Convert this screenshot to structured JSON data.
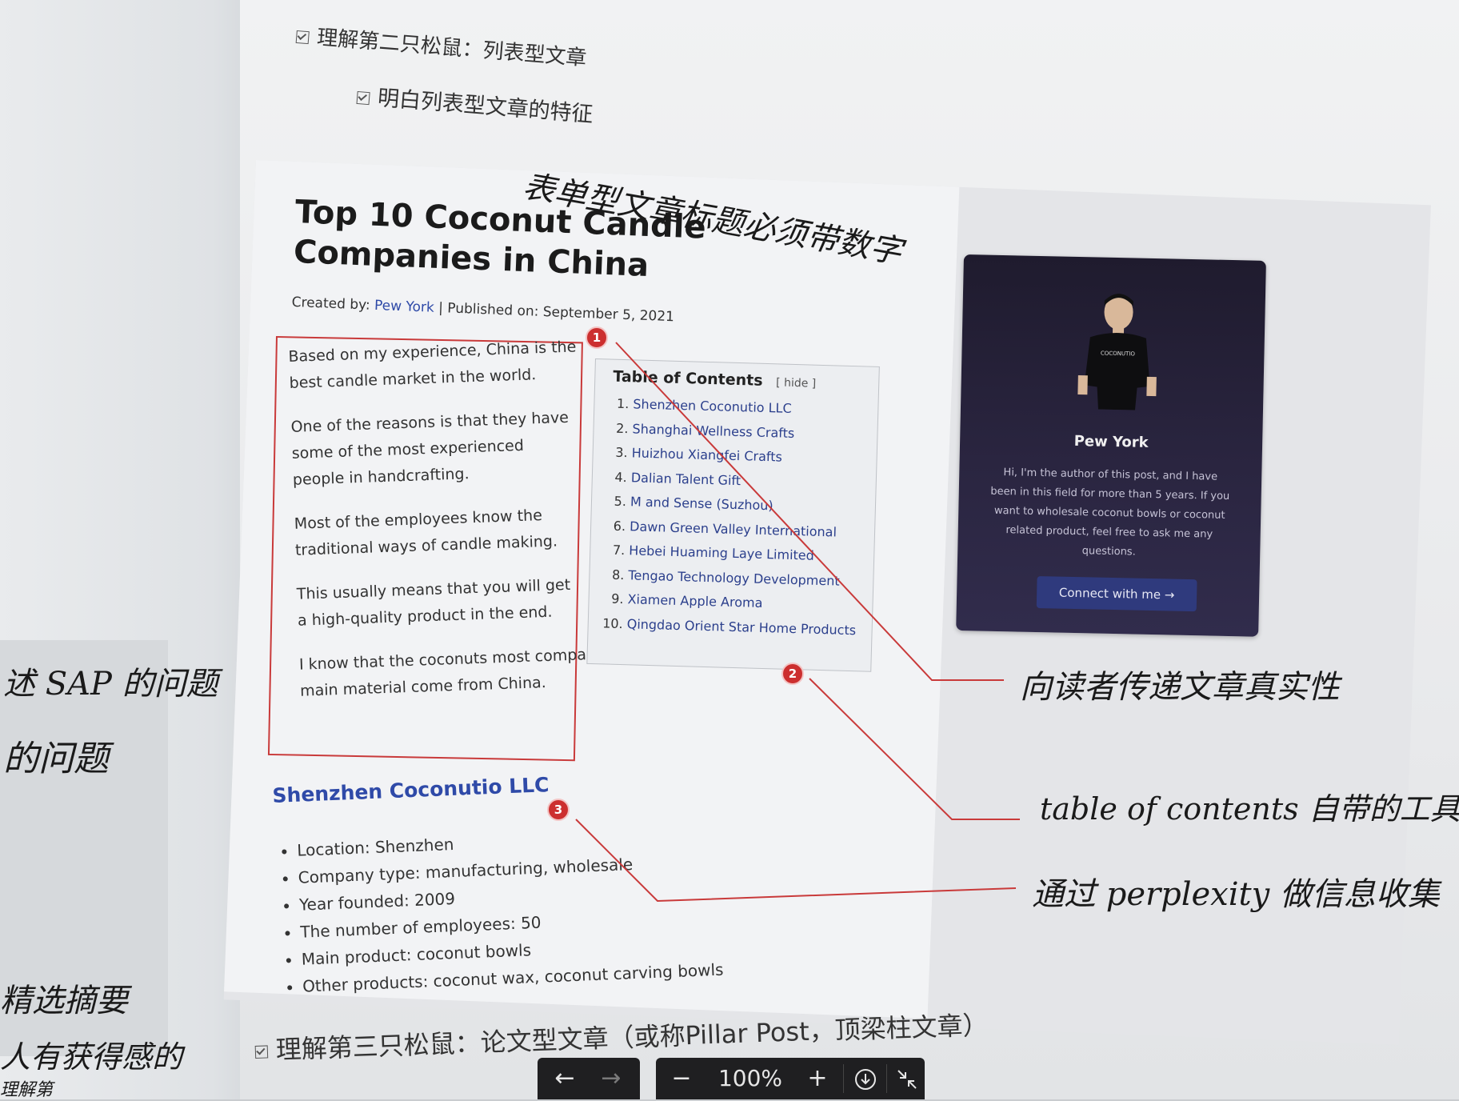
{
  "book": {
    "heading_1": "理解第二只松鼠：列表型文章",
    "heading_2": "明白列表型文章的特征",
    "bottom_line": "理解第三只松鼠：论文型文章（或称Pillar Post，顶梁柱文章）"
  },
  "article": {
    "title": "Top 10 Coconut Candle Companies in China",
    "meta_created_label": "Created by:",
    "meta_author": "Pew York",
    "meta_published": "Published on: September 5, 2021",
    "intro_paragraphs": [
      "Based on my experience, China is the best candle market in the world.",
      "One of the reasons is that they have some of the most experienced people in handcrafting.",
      "Most of the employees know the traditional ways of candle making.",
      "This usually means that you will get a high-quality product in the end.",
      "I know that the coconuts most companies use as the main material come from China."
    ],
    "toc": {
      "title": "Table of Contents",
      "hide_label": "[ hide ]",
      "items": [
        "Shenzhen Coconutio LLC",
        "Shanghai Wellness Crafts",
        "Huizhou Xiangfei Crafts",
        "Dalian Talent Gift",
        "M and Sense (Suzhou)",
        "Dawn Green Valley International",
        "Hebei Huaming Laye Limited",
        "Tengao Technology Development",
        "Xiamen Apple Aroma",
        "Qingdao Orient Star Home Products"
      ]
    },
    "section": {
      "title": "Shenzhen Coconutio LLC",
      "bullets": [
        "Location: Shenzhen",
        "Company type: manufacturing, wholesale",
        "Year founded: 2009",
        "The number of employees: 50",
        "Main product: coconut bowls",
        "Other products: coconut wax, coconut carving bowls"
      ]
    },
    "author_card": {
      "name": "Pew York",
      "bio": "Hi, I'm the author of this post, and I have been in this field for more than 5 years. If you want to wholesale coconut bowls or coconut related product, feel free to ask me any questions.",
      "connect_label": "Connect with me →",
      "shirt_text": "COCONUTIO"
    },
    "markers": [
      "1",
      "2",
      "3"
    ]
  },
  "handwritten": {
    "title_note": "表单型文章标题必须带数字",
    "note_1": "向读者传递文章真实性",
    "note_2": "table of contents 自带的工具",
    "note_3": "通过 perplexity 做信息收集",
    "left_1": "述 SAP 的问题",
    "left_2": "的问题",
    "left_3": "精选摘要",
    "left_4": "人有获得感的",
    "left_5": "理解第"
  },
  "toolbar": {
    "prev_icon": "←",
    "next_icon": "→",
    "zoom_out_icon": "−",
    "zoom_level": "100%",
    "zoom_in_icon": "+",
    "download_icon": "download-icon",
    "collapse_icon": "collapse-icon"
  },
  "colors": {
    "annotation_red": "#cc2f2f",
    "link_blue": "#2f4aa8",
    "card_dark": "#2a2540",
    "toolbar_bg": "#1f1f21"
  }
}
